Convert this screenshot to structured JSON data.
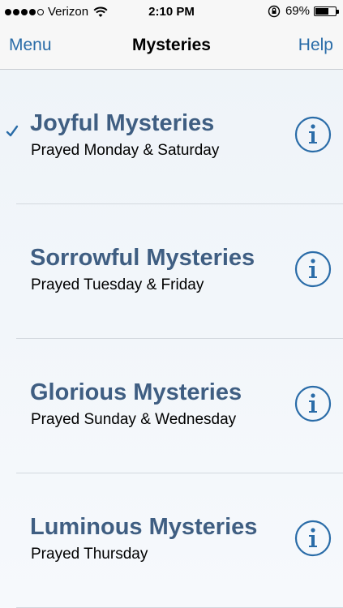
{
  "status_bar": {
    "carrier": "Verizon",
    "time": "2:10 PM",
    "battery_percent": "69%",
    "battery_level": 0.69,
    "signal_bars_filled": 4,
    "signal_bars_total": 5,
    "icons": [
      "wifi-icon",
      "lock-rotation-icon",
      "battery-icon"
    ]
  },
  "nav": {
    "title": "Mysteries",
    "left_label": "Menu",
    "right_label": "Help"
  },
  "colors": {
    "accent": "#2a6ca8",
    "title_text": "#3f5e82",
    "info_icon": "#2a6ca8"
  },
  "mysteries": [
    {
      "title": "Joyful Mysteries",
      "subtitle": "Prayed Monday & Saturday",
      "selected": true
    },
    {
      "title": "Sorrowful Mysteries",
      "subtitle": "Prayed Tuesday & Friday",
      "selected": false
    },
    {
      "title": "Glorious Mysteries",
      "subtitle": "Prayed Sunday & Wednesday",
      "selected": false
    },
    {
      "title": "Luminous Mysteries",
      "subtitle": "Prayed Thursday",
      "selected": false
    }
  ]
}
